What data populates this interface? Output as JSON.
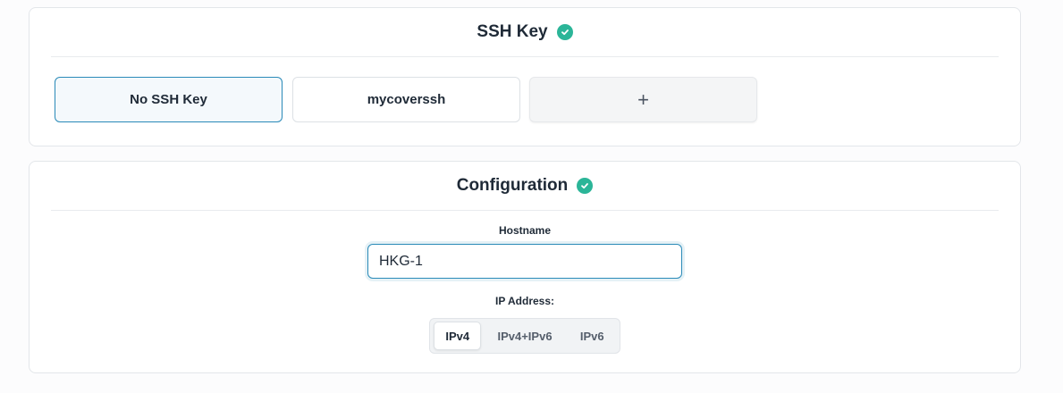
{
  "ssh_key": {
    "title": "SSH Key",
    "options": [
      {
        "label": "No SSH Key",
        "selected": true
      },
      {
        "label": "mycoverssh",
        "selected": false
      }
    ],
    "add_icon": "plus-icon"
  },
  "configuration": {
    "title": "Configuration",
    "hostname_label": "Hostname",
    "hostname_value": "HKG-1",
    "ip_label": "IP Address:",
    "ip_options": [
      "IPv4",
      "IPv4+IPv6",
      "IPv6"
    ],
    "ip_selected": "IPv4"
  },
  "colors": {
    "accent": "#2a8ab8",
    "success": "#2bb598"
  }
}
